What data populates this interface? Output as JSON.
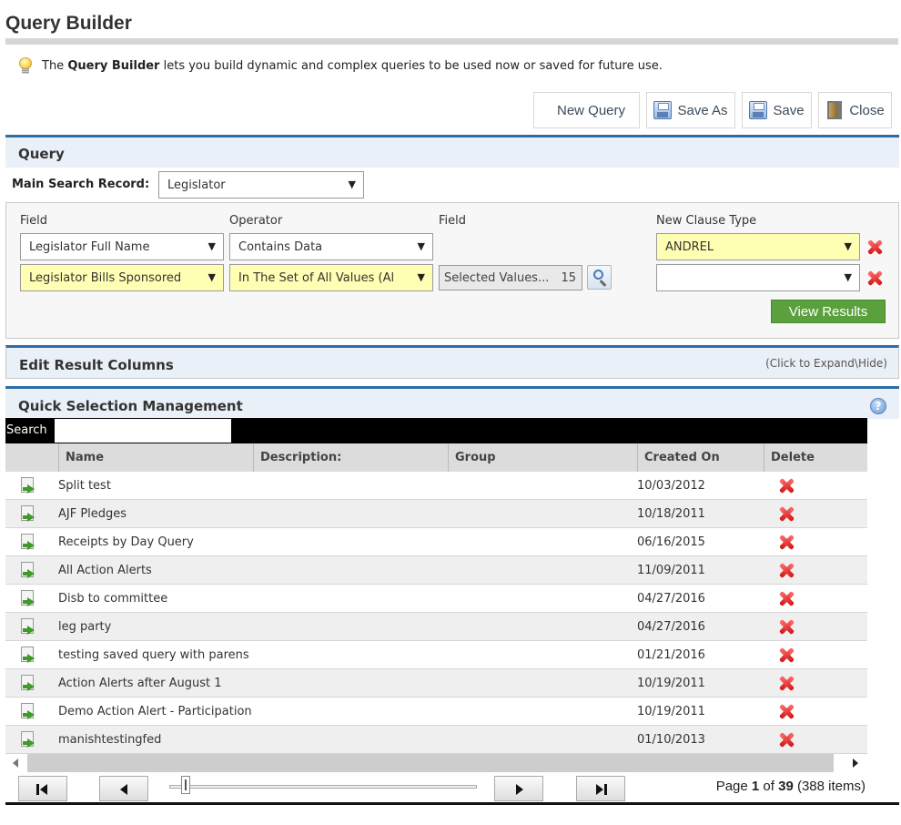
{
  "title": "Query Builder",
  "intro": {
    "prefix": "The",
    "bold": "Query Builder",
    "suffix": "lets you build dynamic and complex queries to be used now or saved for future use."
  },
  "toolbar": {
    "new_query": "New Query",
    "save_as": "Save As",
    "save": "Save",
    "close": "Close"
  },
  "query": {
    "heading": "Query",
    "main_search_label": "Main Search Record:",
    "main_search_value": "Legislator",
    "col_field": "Field",
    "col_operator": "Operator",
    "col_field2": "Field",
    "col_new_clause": "New Clause Type",
    "clauses": [
      {
        "field": "Legislator Full Name",
        "operator": "Contains Data",
        "clause_type": "ANDREL"
      },
      {
        "field": "Legislator Bills Sponsored",
        "operator": "In The Set of All Values (Al",
        "selected_label": "Selected Values...",
        "selected_count": "15",
        "clause_type": ""
      }
    ],
    "view_results": "View Results"
  },
  "edit_columns": {
    "heading": "Edit Result Columns",
    "hint": "(Click to Expand\\Hide)"
  },
  "qsm": {
    "heading": "Quick Selection Management",
    "help": "?",
    "search_label": "Search",
    "search_value": "",
    "columns": [
      "Name",
      "Description:",
      "Group",
      "Created On",
      "Delete"
    ],
    "rows": [
      {
        "name": "Split test",
        "date": "10/03/2012"
      },
      {
        "name": "AJF Pledges",
        "date": "10/18/2011"
      },
      {
        "name": "Receipts by Day Query",
        "date": "06/16/2015"
      },
      {
        "name": "All Action Alerts",
        "date": "11/09/2011"
      },
      {
        "name": "Disb to committee",
        "date": "04/27/2016"
      },
      {
        "name": "leg party",
        "date": "04/27/2016"
      },
      {
        "name": "testing saved query with parens",
        "date": "01/21/2016"
      },
      {
        "name": "Action Alerts after August 1",
        "date": "10/19/2011"
      },
      {
        "name": "Demo Action Alert - Participation",
        "date": "10/19/2011"
      },
      {
        "name": "manishtestingfed",
        "date": "01/10/2013"
      }
    ],
    "pager": {
      "page_word": "Page",
      "current": "1",
      "of_word": "of",
      "total": "39",
      "items": "(388 items)"
    }
  },
  "colors": {
    "accent_blue": "#2e6da4",
    "panel_bg": "#eaf0f7",
    "highlight_yellow": "#ffffb3",
    "view_results_green": "#5aa03c",
    "delete_red": "#d01818"
  }
}
